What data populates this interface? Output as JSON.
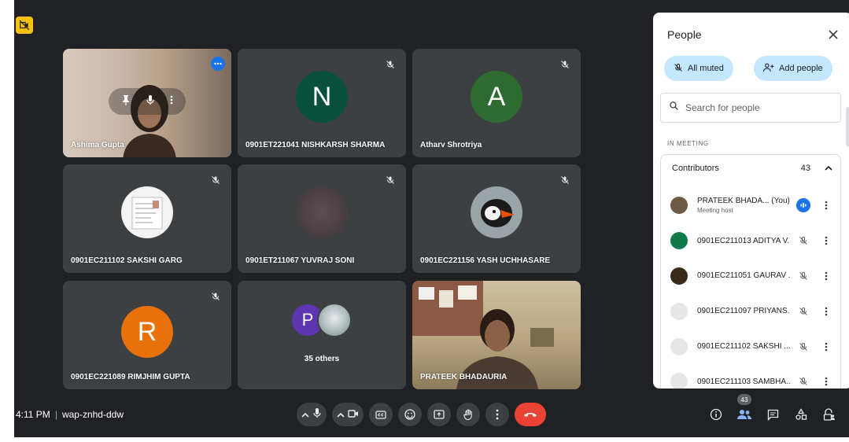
{
  "meeting": {
    "time": "4:11 PM",
    "code": "wap-znhd-ddw"
  },
  "tiles": [
    {
      "name": "Ashima Gupta",
      "type": "video"
    },
    {
      "name": "0901ET221041 NISHKARSH SHARMA",
      "initial": "N",
      "color": "#0b4f3d"
    },
    {
      "name": "Atharv Shrotriya",
      "initial": "A",
      "color": "#2e6b30"
    },
    {
      "name": "0901EC211102 SAKSHI GARG",
      "type": "photo"
    },
    {
      "name": "0901ET211067 YUVRAJ SONI",
      "type": "photo"
    },
    {
      "name": "0901EC221156 YASH UCHHASARE",
      "type": "photo"
    },
    {
      "name": "0901EC221089 RIMJHIM GUPTA",
      "initial": "R",
      "color": "#e8710a"
    },
    {
      "name": "35 others",
      "initial": "P",
      "color": "#5e35b1"
    },
    {
      "name": "PRATEEK BHADAURIA",
      "type": "video"
    }
  ],
  "panel": {
    "title": "People",
    "all_muted": "All muted",
    "add_people": "Add people",
    "search_placeholder": "Search for people",
    "section": "IN MEETING",
    "group": "Contributors",
    "group_count": "43",
    "people": [
      {
        "name": "PRATEEK BHADA...",
        "you": "(You)",
        "sub": "Meeting host",
        "avatar_color": "#6d5a45"
      },
      {
        "name": "0901EC211013 ADITYA V...",
        "avatar_color": "#0f7a4b"
      },
      {
        "name": "0901EC211051 GAURAV ...",
        "avatar_color": "#3a2a1a"
      },
      {
        "name": "0901EC211097 PRIYANS...",
        "avatar_color": "#e6e6e6"
      },
      {
        "name": "0901EC211102 SAKSHI ...",
        "avatar_color": "#e6e6e6"
      },
      {
        "name": "0901EC211103 SAMBHA...",
        "avatar_color": "#e6e6e6"
      }
    ]
  },
  "controls": {
    "people_count": "43"
  },
  "colors": {
    "background": "#202124",
    "tile": "#3c4043",
    "accent": "#1a73e8",
    "end_call": "#ea4335",
    "chip": "#c2e7ff"
  }
}
